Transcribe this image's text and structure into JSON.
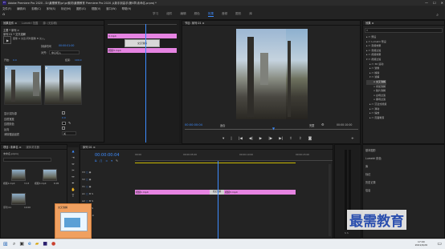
{
  "window": {
    "title": "Adobe Premiere Pro 2020 - D:\\最需教育\\pr\\pr素材\\最需教育 Premiere Pro 2020 从新手到高手\\第5章\\未命名.prproj *",
    "minimize": "—",
    "maximize": "☐",
    "close": "✕"
  },
  "menu": [
    "文件(F)",
    "编辑(E)",
    "剪辑(C)",
    "序列(S)",
    "标记(M)",
    "图形(G)",
    "视图(V)",
    "窗口(W)",
    "帮助(H)"
  ],
  "workspaces": [
    "学习",
    "组件",
    "编辑",
    "颜色",
    "效果",
    "音频",
    "图形",
    "库"
  ],
  "active_workspace": "效果",
  "effect_controls": {
    "tabs": [
      "效果控件 ≡",
      "Lumetri 范围",
      "源: (无剪辑)",
      "音频剪辑混合器"
    ],
    "source_row": "主要 * 序列 >",
    "source_seq": "序列 01 * 交叉溶解",
    "transition_label": "交叉溶解",
    "transition_desc": "图像 A 淡出,同时图像 B 淡入。",
    "duration_label": "持续时间",
    "duration_value": "00:00:01:00",
    "alignment_label": "对齐:",
    "alignment_value": "中心切入",
    "start_value": "0.0",
    "end_value": "100.0",
    "start_label": "开始:",
    "end_label": "结束:",
    "options": [
      "显示实际源",
      "边框宽度",
      "边框颜色",
      "反向",
      "消除锯齿品质"
    ],
    "aa_value": "关",
    "border_value": "0.0",
    "timestamp": "00:00:00:04",
    "clip_a": "9.mp4",
    "clip_b": "视频3.mp4",
    "clip_c": "视频1.mp4",
    "trans": "交叉溶解"
  },
  "program": {
    "tab": "节目: 序列 01 ≡",
    "timecode_left": "00:00:00:04",
    "fit": "适合",
    "full": "完整",
    "timecode_right": "00:00:10:00"
  },
  "effects_panel": {
    "tab": "效果 ≡",
    "items": [
      "预设",
      "Lumetri 预设",
      "音频效果",
      "音频过渡",
      "视频效果",
      "视频过渡",
      "3D 运动",
      "划像",
      "擦除",
      "溶解",
      "交叉溶解",
      "叠加溶解",
      "胶片溶解",
      "白场过渡",
      "黑场过渡",
      "沉浸式视频",
      "滑动",
      "缩放",
      "页面剥落"
    ]
  },
  "project": {
    "tabs": [
      "项目: 未命名 ≡",
      "媒体浏览器"
    ],
    "name": "未命名.prproj",
    "clips": [
      {
        "name": "视频1.mp4",
        "dur": "3:13"
      },
      {
        "name": "视频3.mp4",
        "dur": "6:05"
      },
      {
        "name": "序列 01",
        "dur": "10:00"
      }
    ]
  },
  "timeline": {
    "tab": "序列 01 ≡",
    "timecode": "00:00:00:04",
    "ruler": [
      "00:00",
      "00:00:05:00",
      "00:00:10:00",
      "00:00:15:00"
    ],
    "tracks": [
      "V3",
      "V2",
      "V1",
      "A1",
      "A2",
      "A3",
      "主声道"
    ],
    "master_val": "0.0",
    "clip_v1a": "视频1.mp4",
    "clip_v1b": "视频3.mp4",
    "trans_label": "交叉溶解"
  },
  "essential": {
    "items": [
      "基本图形",
      "Lumetri 颜色",
      "库",
      "标记",
      "历史记录",
      "信息"
    ]
  },
  "popup": {
    "title": "交叉溶解"
  },
  "watermark": "最需教育",
  "taskbar": {
    "time": "17:00",
    "date": "2021/9/26"
  },
  "colors": {
    "accent": "#3d8cff",
    "clip_pink": "#e684e2",
    "playhead": "#3d8cff"
  }
}
